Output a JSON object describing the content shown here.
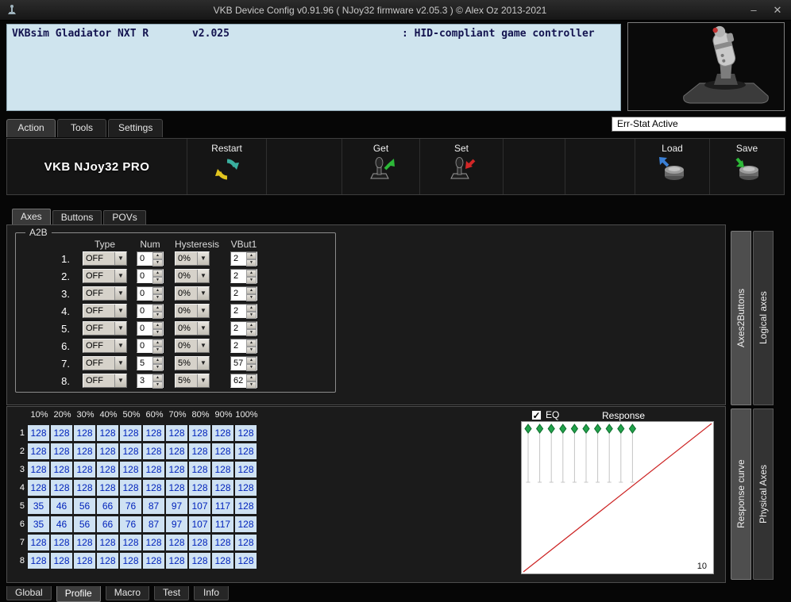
{
  "window": {
    "title": "VKB Device Config v0.91.96 ( NJoy32 firmware v2.05.3 ) © Alex Oz 2013-2021"
  },
  "icons": {
    "minimize": "–",
    "close": "✕",
    "dropdown": "▼",
    "up": "▲",
    "down": "▼",
    "check": "✓"
  },
  "device_info": {
    "name": "VKBsim Gladiator NXT R       v2.025",
    "hid": ": HID-compliant game controller"
  },
  "err_stat": "Err-Stat Active",
  "main_tabs": [
    {
      "label": "Action",
      "active": true
    },
    {
      "label": "Tools",
      "active": false
    },
    {
      "label": "Settings",
      "active": false
    }
  ],
  "toolbar": {
    "brand": "VKB NJoy32 PRO",
    "restart": "Restart",
    "get": "Get",
    "set": "Set",
    "load": "Load",
    "save": "Save"
  },
  "axes_tabs": [
    {
      "label": "Axes",
      "active": true
    },
    {
      "label": "Buttons",
      "active": false
    },
    {
      "label": "POVs",
      "active": false
    }
  ],
  "a2b": {
    "title": "A2B",
    "headers": [
      "Type",
      "Num",
      "Hysteresis",
      "VBut1"
    ],
    "rows": [
      {
        "index": "1.",
        "type": "OFF",
        "num": "0",
        "hyst": "0%",
        "vbut": "2"
      },
      {
        "index": "2.",
        "type": "OFF",
        "num": "0",
        "hyst": "0%",
        "vbut": "2"
      },
      {
        "index": "3.",
        "type": "OFF",
        "num": "0",
        "hyst": "0%",
        "vbut": "2"
      },
      {
        "index": "4.",
        "type": "OFF",
        "num": "0",
        "hyst": "0%",
        "vbut": "2"
      },
      {
        "index": "5.",
        "type": "OFF",
        "num": "0",
        "hyst": "0%",
        "vbut": "2"
      },
      {
        "index": "6.",
        "type": "OFF",
        "num": "0",
        "hyst": "0%",
        "vbut": "2"
      },
      {
        "index": "7.",
        "type": "OFF",
        "num": "5",
        "hyst": "5%",
        "vbut": "57"
      },
      {
        "index": "8.",
        "type": "OFF",
        "num": "3",
        "hyst": "5%",
        "vbut": "62"
      }
    ]
  },
  "side_tabs_upper": [
    {
      "label": "Axes2Buttons",
      "active": true
    },
    {
      "label": "Logical axes",
      "active": false
    }
  ],
  "side_tabs_lower": [
    {
      "label": "Response curve",
      "active": true
    },
    {
      "label": "Physical Axes",
      "active": false
    }
  ],
  "curve_table": {
    "headers": [
      "10%",
      "20%",
      "30%",
      "40%",
      "50%",
      "60%",
      "70%",
      "80%",
      "90%",
      "100%"
    ],
    "rows": [
      {
        "label": "1",
        "values": [
          128,
          128,
          128,
          128,
          128,
          128,
          128,
          128,
          128,
          128
        ]
      },
      {
        "label": "2",
        "values": [
          128,
          128,
          128,
          128,
          128,
          128,
          128,
          128,
          128,
          128
        ]
      },
      {
        "label": "3",
        "values": [
          128,
          128,
          128,
          128,
          128,
          128,
          128,
          128,
          128,
          128
        ]
      },
      {
        "label": "4",
        "values": [
          128,
          128,
          128,
          128,
          128,
          128,
          128,
          128,
          128,
          128
        ]
      },
      {
        "label": "5",
        "values": [
          35,
          46,
          56,
          66,
          76,
          87,
          97,
          107,
          117,
          128
        ]
      },
      {
        "label": "6",
        "values": [
          35,
          46,
          56,
          66,
          76,
          87,
          97,
          107,
          117,
          128
        ]
      },
      {
        "label": "7",
        "values": [
          128,
          128,
          128,
          128,
          128,
          128,
          128,
          128,
          128,
          128
        ]
      },
      {
        "label": "8",
        "values": [
          128,
          128,
          128,
          128,
          128,
          128,
          128,
          128,
          128,
          128
        ]
      }
    ]
  },
  "response": {
    "eq_label": "EQ",
    "eq_checked": true,
    "title": "Response",
    "max_label": "10",
    "slider_count": 10
  },
  "bottom_tabs": [
    {
      "label": "Global",
      "active": false
    },
    {
      "label": "Profile",
      "active": true
    },
    {
      "label": "Macro",
      "active": false
    },
    {
      "label": "Test",
      "active": false
    },
    {
      "label": "Info",
      "active": false
    }
  ],
  "colors": {
    "info_bg": "#cfe4ee",
    "cell_bg": "#cfe2f3",
    "cell_text": "#0022bb",
    "curve_line": "#cc2222",
    "marker_green": "#21a24b"
  }
}
